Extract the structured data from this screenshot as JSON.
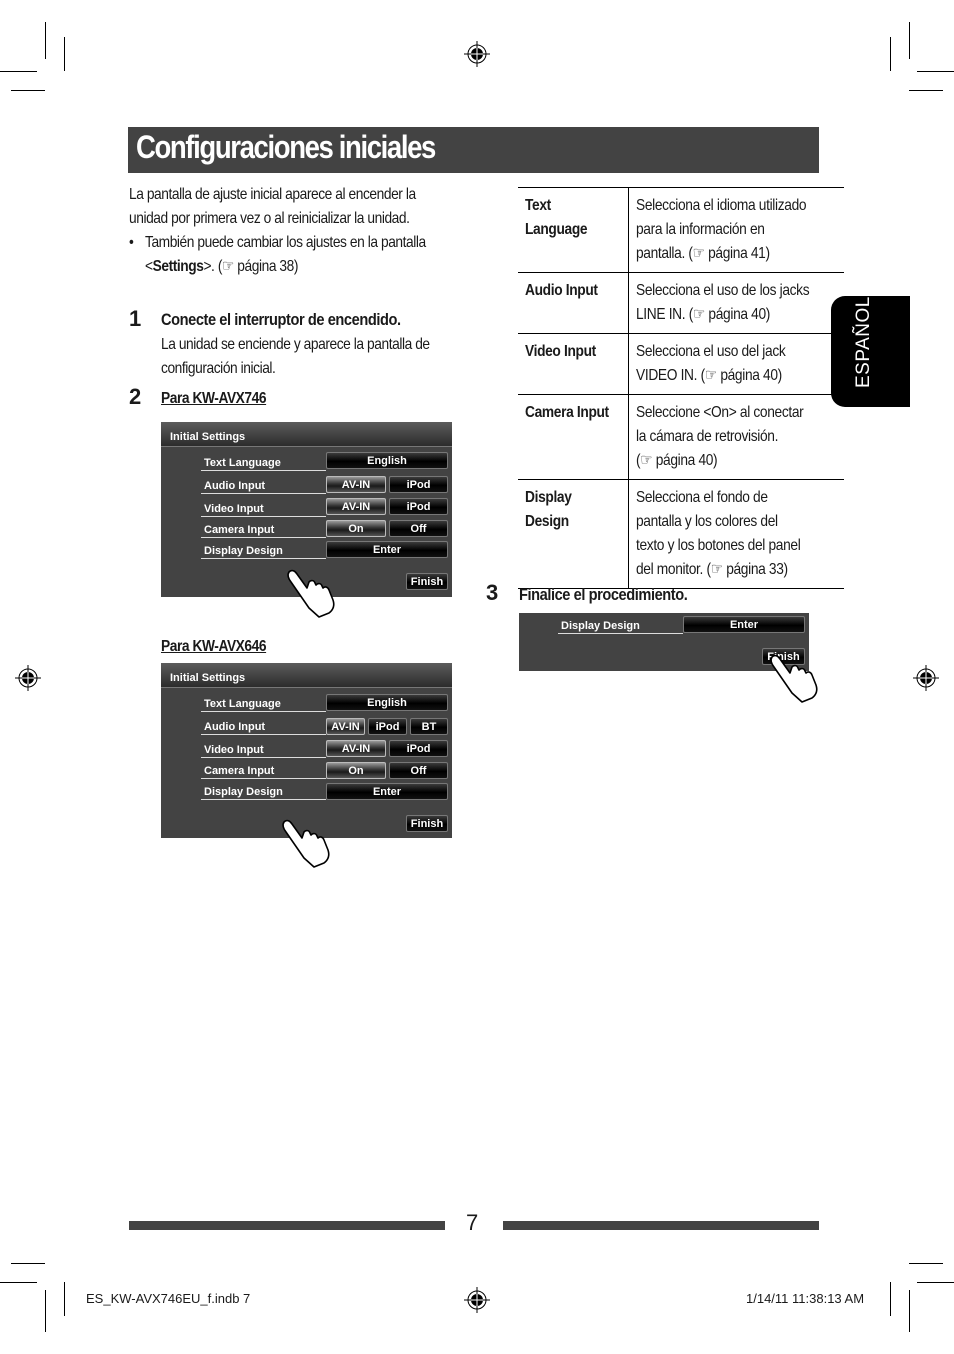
{
  "title": "Configuraciones iniciales",
  "intro": {
    "line1": "La pantalla de ajuste inicial aparece al encender la",
    "line2": "unidad por primera vez o al reinicializar la unidad.",
    "bullet": "•",
    "bullet_line1": "También puede cambiar los ajustes en la pantalla",
    "bullet_line2_pre": "<",
    "bullet_line2_bold": "Settings",
    "bullet_line2_post": ">. (☞ página 38)"
  },
  "steps": [
    {
      "number": "1",
      "heading": "Conecte el interruptor de encendido.",
      "body_line1": "La unidad se enciende y aparece la pantalla de",
      "body_line2": "configuración inicial."
    },
    {
      "number": "2",
      "model_a": "Para KW-AVX746",
      "model_b": "Para KW-AVX646"
    },
    {
      "number": "3",
      "heading": "Finalice el procedimiento."
    }
  ],
  "screen_avx746": {
    "title": "Initial Settings",
    "rows": [
      {
        "label": "Text Language",
        "buttons": [
          "English"
        ]
      },
      {
        "label": "Audio Input",
        "buttons": [
          "AV-IN",
          "iPod"
        ],
        "selected": "AV-IN"
      },
      {
        "label": "Video Input",
        "buttons": [
          "AV-IN",
          "iPod"
        ],
        "selected": "AV-IN"
      },
      {
        "label": "Camera Input",
        "buttons": [
          "On",
          "Off"
        ],
        "selected": "On"
      },
      {
        "label": "Display Design",
        "buttons": [
          "Enter"
        ]
      }
    ],
    "finish": "Finish"
  },
  "screen_avx646": {
    "title": "Initial Settings",
    "rows": [
      {
        "label": "Text Language",
        "buttons": [
          "English"
        ]
      },
      {
        "label": "Audio Input",
        "buttons": [
          "AV-IN",
          "iPod",
          "BT"
        ],
        "selected": "AV-IN"
      },
      {
        "label": "Video Input",
        "buttons": [
          "AV-IN",
          "iPod"
        ],
        "selected": "AV-IN"
      },
      {
        "label": "Camera Input",
        "buttons": [
          "On",
          "Off"
        ],
        "selected": "On"
      },
      {
        "label": "Display Design",
        "buttons": [
          "Enter"
        ]
      }
    ],
    "finish": "Finish"
  },
  "screen_finish": {
    "label": "Display Design",
    "enter": "Enter",
    "finish": "Finish"
  },
  "table": [
    {
      "key_lines": [
        "Text",
        "Language"
      ],
      "desc_lines": [
        "Selecciona el idioma utilizado",
        "para la información en",
        "pantalla. (☞ página 41)"
      ]
    },
    {
      "key_lines": [
        "Audio Input"
      ],
      "desc_lines": [
        "Selecciona el uso de los jacks",
        "LINE IN. (☞ página 40)"
      ]
    },
    {
      "key_lines": [
        "Video Input"
      ],
      "desc_lines": [
        "Selecciona el uso del jack",
        "VIDEO IN. (☞ página 40)"
      ]
    },
    {
      "key_lines": [
        "Camera Input"
      ],
      "desc_lines": [
        "Seleccione <On> al conectar",
        "la cámara de retrovisión.",
        "(☞ página 40)"
      ]
    },
    {
      "key_lines": [
        "Display",
        "Design"
      ],
      "desc_lines": [
        "Selecciona el fondo de",
        "pantalla y los colores del",
        "texto y los botones del panel",
        "del monitor. (☞ página 33)"
      ]
    }
  ],
  "side_tab": "ESPAÑOL",
  "page_number": "7",
  "slug_left": "ES_KW-AVX746EU_f.indb   7",
  "slug_right": "1/14/11   11:38:13 AM",
  "colors": {
    "title_bar": "#434343",
    "screen_bg": "#434343",
    "side_tab": "#000000"
  }
}
